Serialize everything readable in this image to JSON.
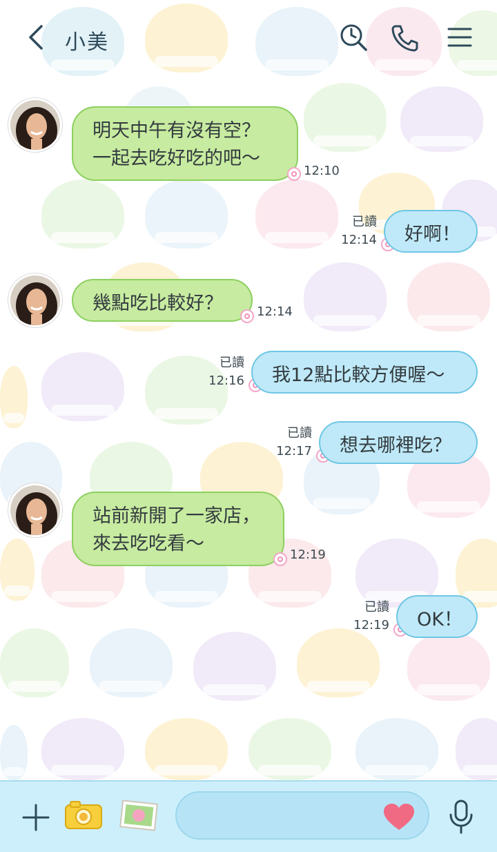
{
  "header": {
    "title": "小美",
    "icons": [
      "back-chevron-icon",
      "search-history-icon",
      "phone-icon",
      "menu-icon"
    ]
  },
  "messages": [
    {
      "side": "in",
      "text": "明天中午有沒有空？\n一起去吃好吃的吧～",
      "time": "12:10"
    },
    {
      "side": "out",
      "text": "好啊！",
      "read": "已讀",
      "time": "12:14"
    },
    {
      "side": "in",
      "text": "幾點吃比較好？",
      "time": "12:14"
    },
    {
      "side": "out",
      "text": "我12點比較方便喔～",
      "read": "已讀",
      "time": "12:16"
    },
    {
      "side": "out",
      "text": "想去哪裡吃？",
      "read": "已讀",
      "time": "12:17"
    },
    {
      "side": "in",
      "text": "站前新開了一家店，\n來去吃吃看～",
      "time": "12:19"
    },
    {
      "side": "out",
      "text": "OK！",
      "read": "已讀",
      "time": "12:19"
    }
  ],
  "bottom_bar": {
    "icons": [
      "plus-icon",
      "camera-icon",
      "photo-icon",
      "heart-icon",
      "microphone-icon"
    ],
    "input_value": ""
  },
  "colors": {
    "incoming_bubble": "#c7eba0",
    "outgoing_bubble": "#bfe9f8",
    "bottom_bar": "#cdeffb",
    "heart": "#f06a84"
  }
}
